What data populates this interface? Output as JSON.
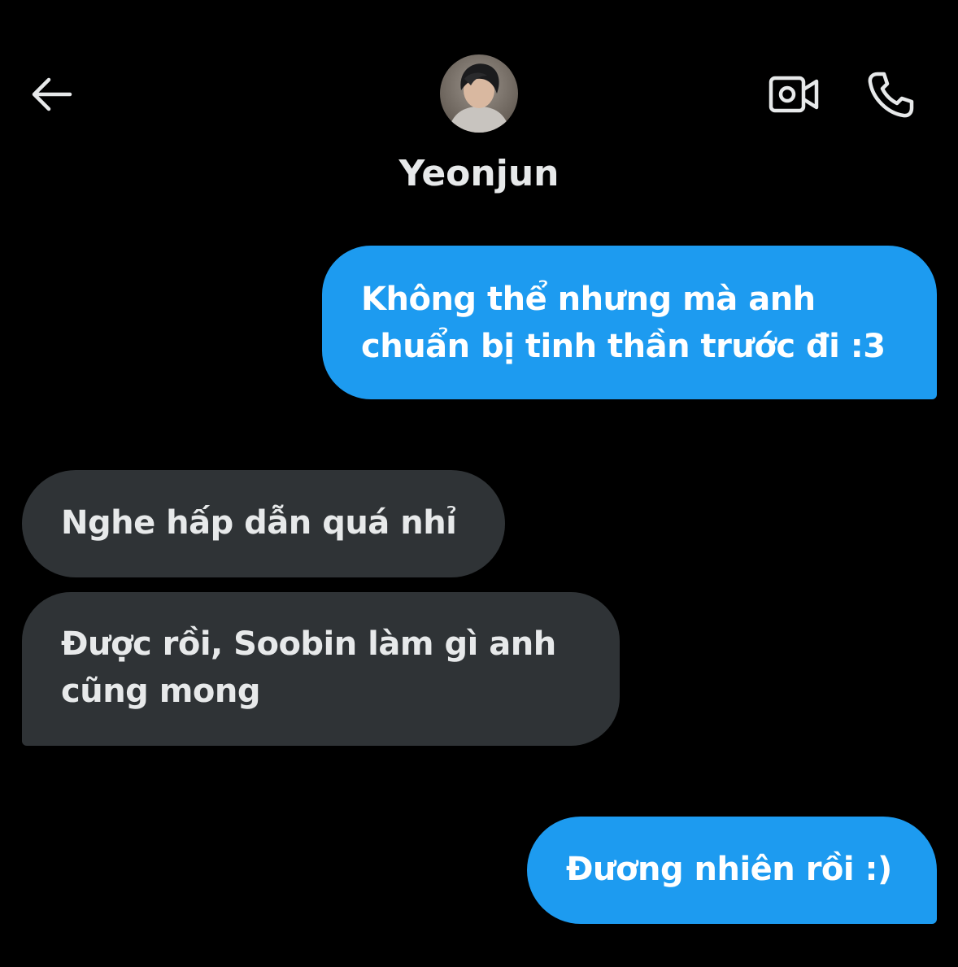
{
  "header": {
    "contact_name": "Yeonjun",
    "back_icon": "arrow-left-icon",
    "video_icon": "video-camera-icon",
    "call_icon": "phone-icon"
  },
  "colors": {
    "background": "#000000",
    "sent_bubble": "#1d9bf0",
    "received_bubble": "#2f3336",
    "text": "#e7e9ea"
  },
  "messages": [
    {
      "direction": "sent",
      "text": "Không thể nhưng mà anh\nchuẩn bị tinh thần trước đi :3"
    },
    {
      "direction": "received",
      "text": "Nghe hấp dẫn quá nhỉ"
    },
    {
      "direction": "received",
      "text": "Được rồi, Soobin làm gì anh\ncũng mong"
    },
    {
      "direction": "sent",
      "text": "Đương nhiên rồi :)"
    }
  ]
}
